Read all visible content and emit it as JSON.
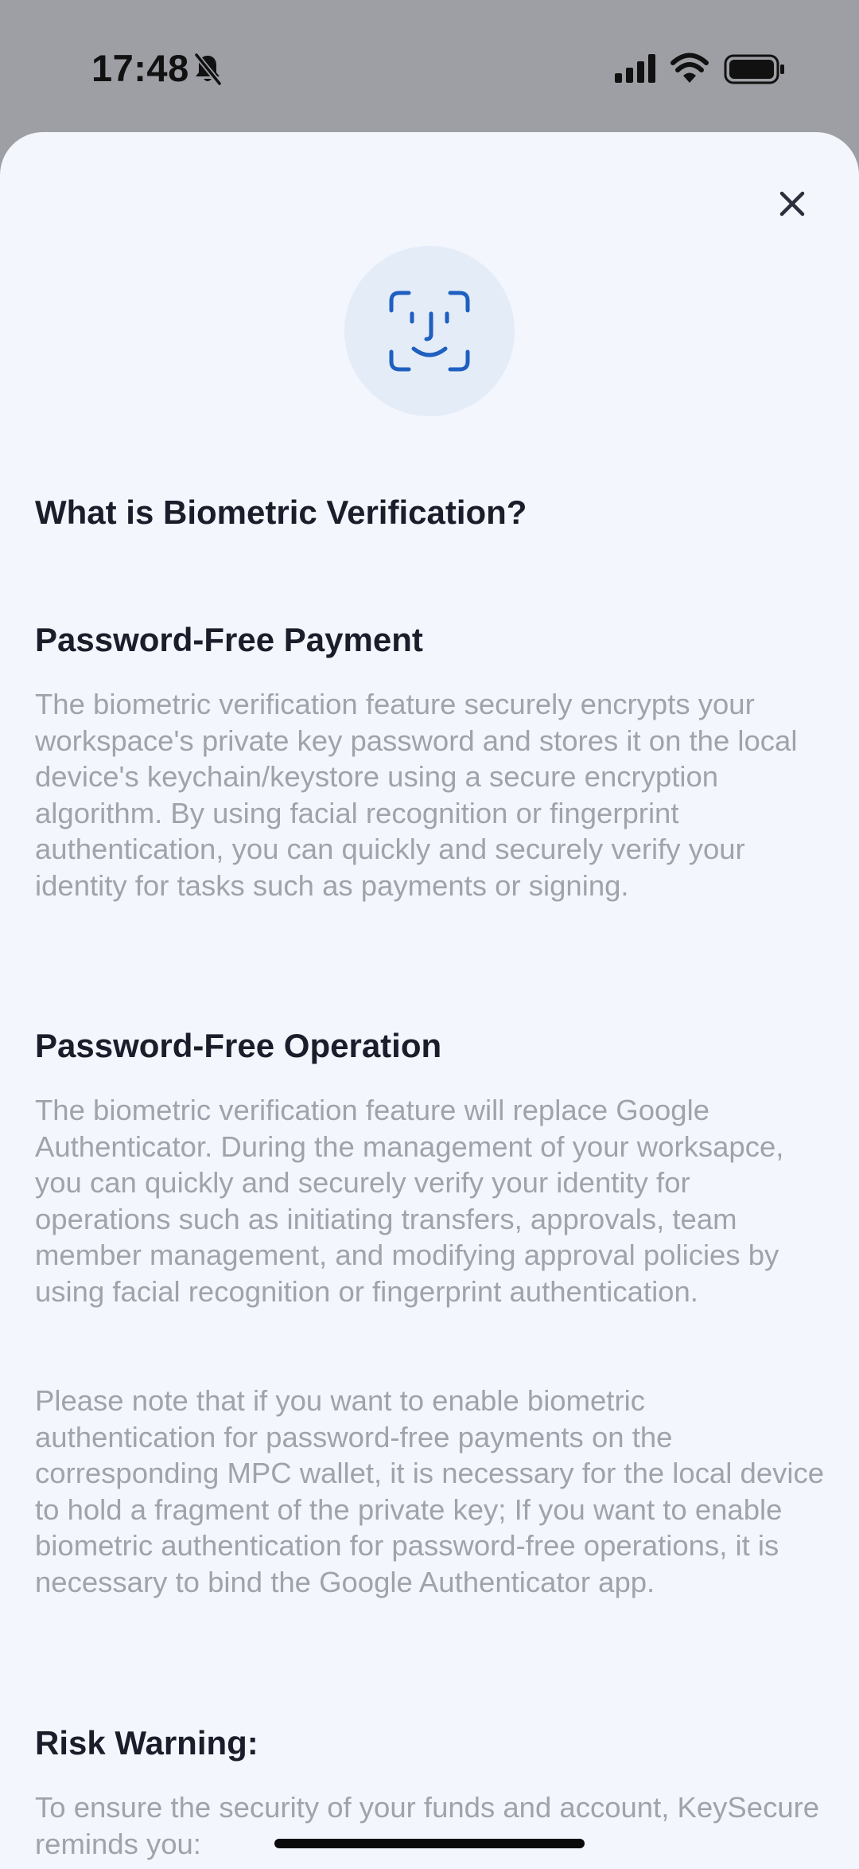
{
  "status_bar": {
    "time": "17:48"
  },
  "sheet": {
    "title": "What is Biometric Verification?",
    "sections": [
      {
        "heading": "Password-Free Payment",
        "paragraphs": [
          "The biometric verification feature securely encrypts your workspace's private key password and stores it on the local device's keychain/keystore using a secure encryption algorithm. By using facial recognition or fingerprint authentication, you can quickly and securely verify your identity for tasks such as payments or signing."
        ]
      },
      {
        "heading": "Password-Free Operation",
        "paragraphs": [
          "The biometric verification feature will replace Google Authenticator. During the management of your worksapce, you can quickly and securely verify your identity for operations such as initiating transfers, approvals, team member management, and modifying approval policies by using facial recognition or fingerprint authentication.",
          "Please note that if you want to enable biometric authentication for password-free payments on the corresponding MPC wallet, it is necessary for the local device to hold a fragment of the private key; If you want to enable biometric authentication for password-free operations, it is necessary to bind the Google Authenticator app."
        ]
      },
      {
        "heading": "Risk Warning:",
        "paragraphs": [
          "To ensure the security of your funds and account, KeySecure reminds you:"
        ]
      }
    ]
  },
  "icons": {
    "close": "close-icon",
    "face_id": "face-id-icon",
    "bell": "bell-slash-icon",
    "signal": "cellular-signal-icon",
    "wifi": "wifi-icon",
    "battery": "battery-icon"
  },
  "colors": {
    "sheet_background": "#f3f6fd",
    "backdrop": "#9e9fa4",
    "accent_blue": "#1f5fbf",
    "icon_circle": "#e4ecf8",
    "heading_text": "#1b1d2b",
    "body_text": "#a0a3ab"
  }
}
